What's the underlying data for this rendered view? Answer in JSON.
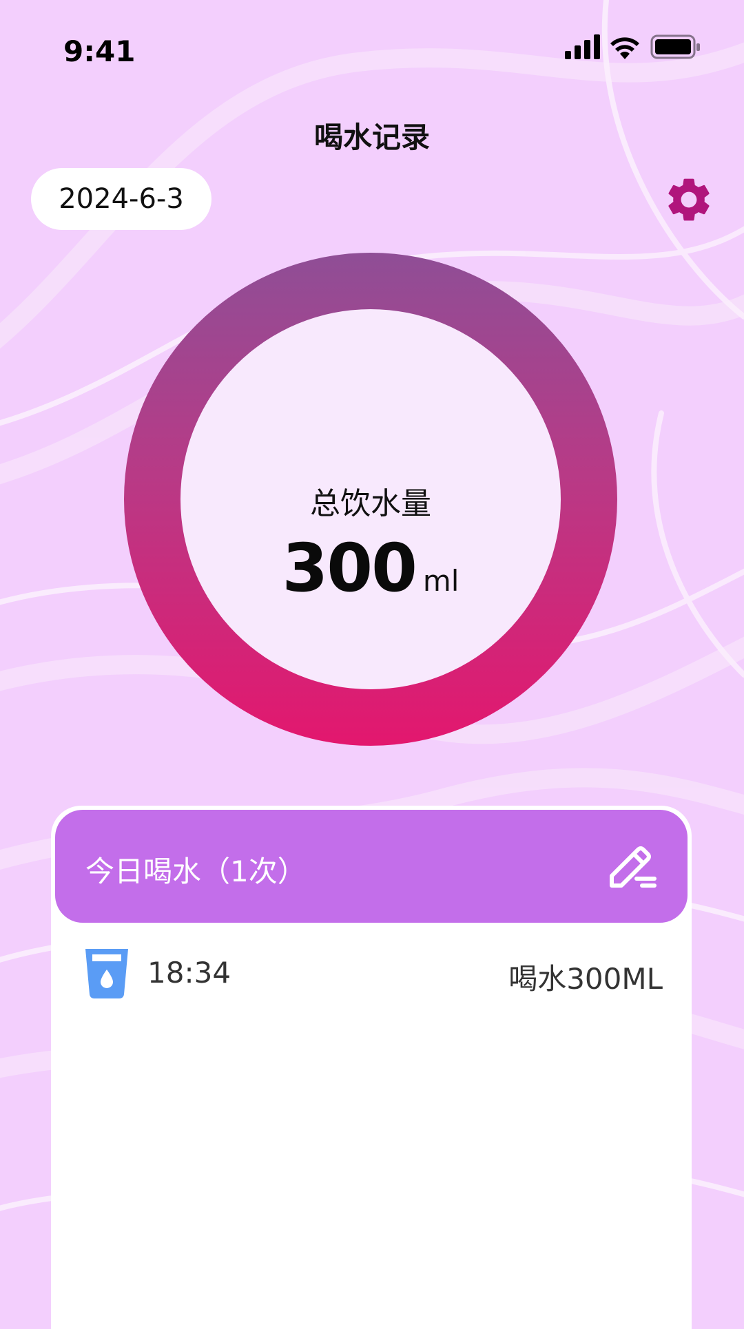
{
  "status_bar": {
    "time": "9:41",
    "icons": [
      "signal-icon",
      "wifi-icon",
      "battery-icon"
    ]
  },
  "header": {
    "title": "喝水记录",
    "date": "2024-6-3",
    "settings_icon": "gear-icon"
  },
  "summary": {
    "label": "总饮水量",
    "value": "300",
    "unit": "ml"
  },
  "records_card": {
    "title": "今日喝水（1次）",
    "edit_icon": "edit-pencil-icon",
    "items": [
      {
        "icon": "water-cup-icon",
        "time": "18:34",
        "amount": "喝水300ML"
      }
    ]
  },
  "colors": {
    "background": "#f3cffd",
    "ring_top": "#8f4e96",
    "ring_bottom": "#e3176e",
    "ring_inner": "#f8e9fd",
    "card_header": "#c36eea",
    "accent_gear": "#b0157c",
    "cup_blue": "#5a9cf5"
  }
}
